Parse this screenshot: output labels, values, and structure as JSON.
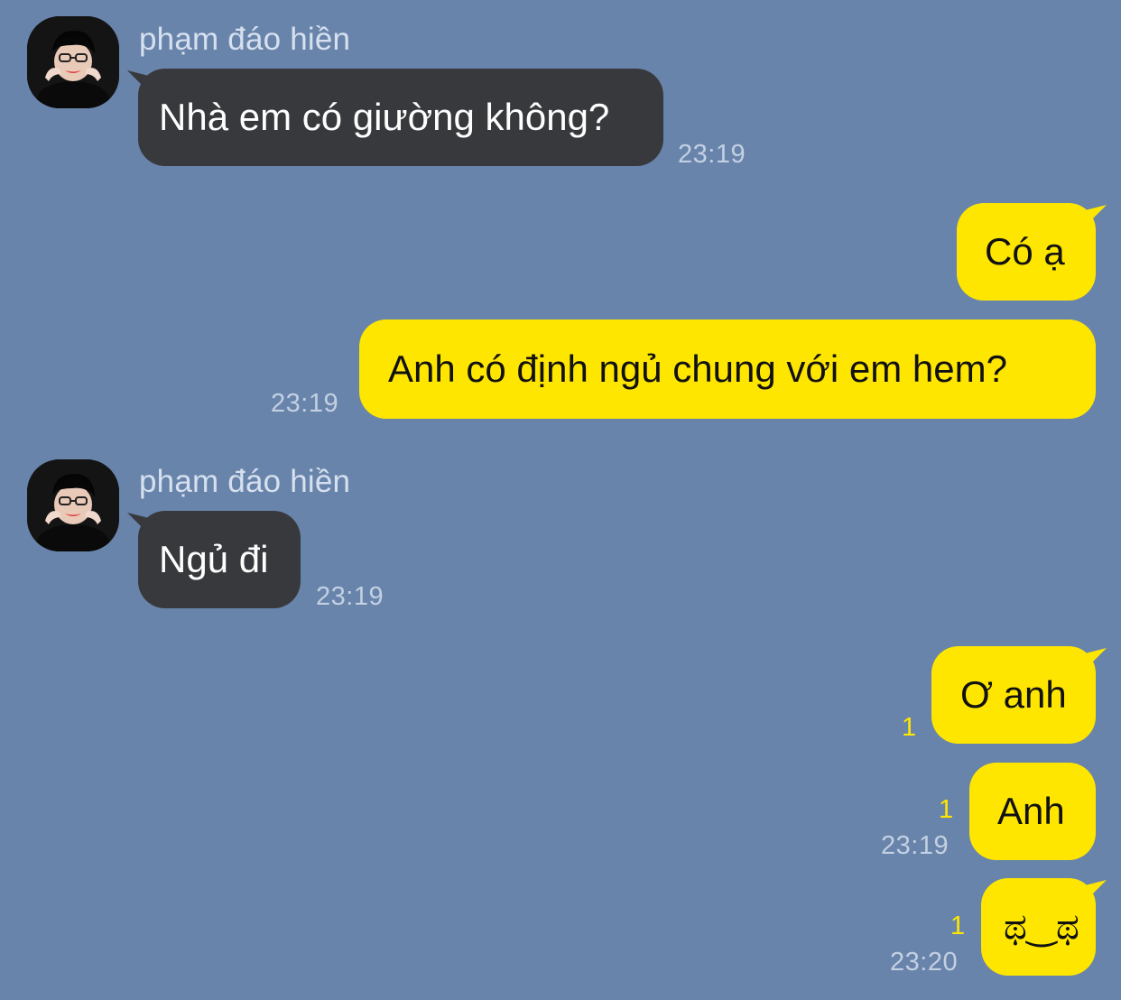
{
  "chat": {
    "messages": [
      {
        "sender": "phạm đáo hiền",
        "text": "Nhà em có giường không?",
        "time": "23:19"
      },
      {
        "text": "Có ạ"
      },
      {
        "text": "Anh có định ngủ chung với em hem?",
        "time": "23:19"
      },
      {
        "sender": "phạm đáo hiền",
        "text": "Ngủ đi",
        "time": "23:19"
      },
      {
        "text": "Ơ anh",
        "unread": "1"
      },
      {
        "text": "Anh",
        "unread": "1",
        "time": "23:19"
      },
      {
        "text": "ಥ‿ಥ",
        "unread": "1",
        "time": "23:20"
      }
    ]
  },
  "colors": {
    "background": "#6884ab",
    "incoming_bubble": "#38393d",
    "outgoing_bubble": "#ffe600",
    "unread_count": "#ffe600"
  },
  "icons": {
    "avatar": "profile-photo"
  }
}
